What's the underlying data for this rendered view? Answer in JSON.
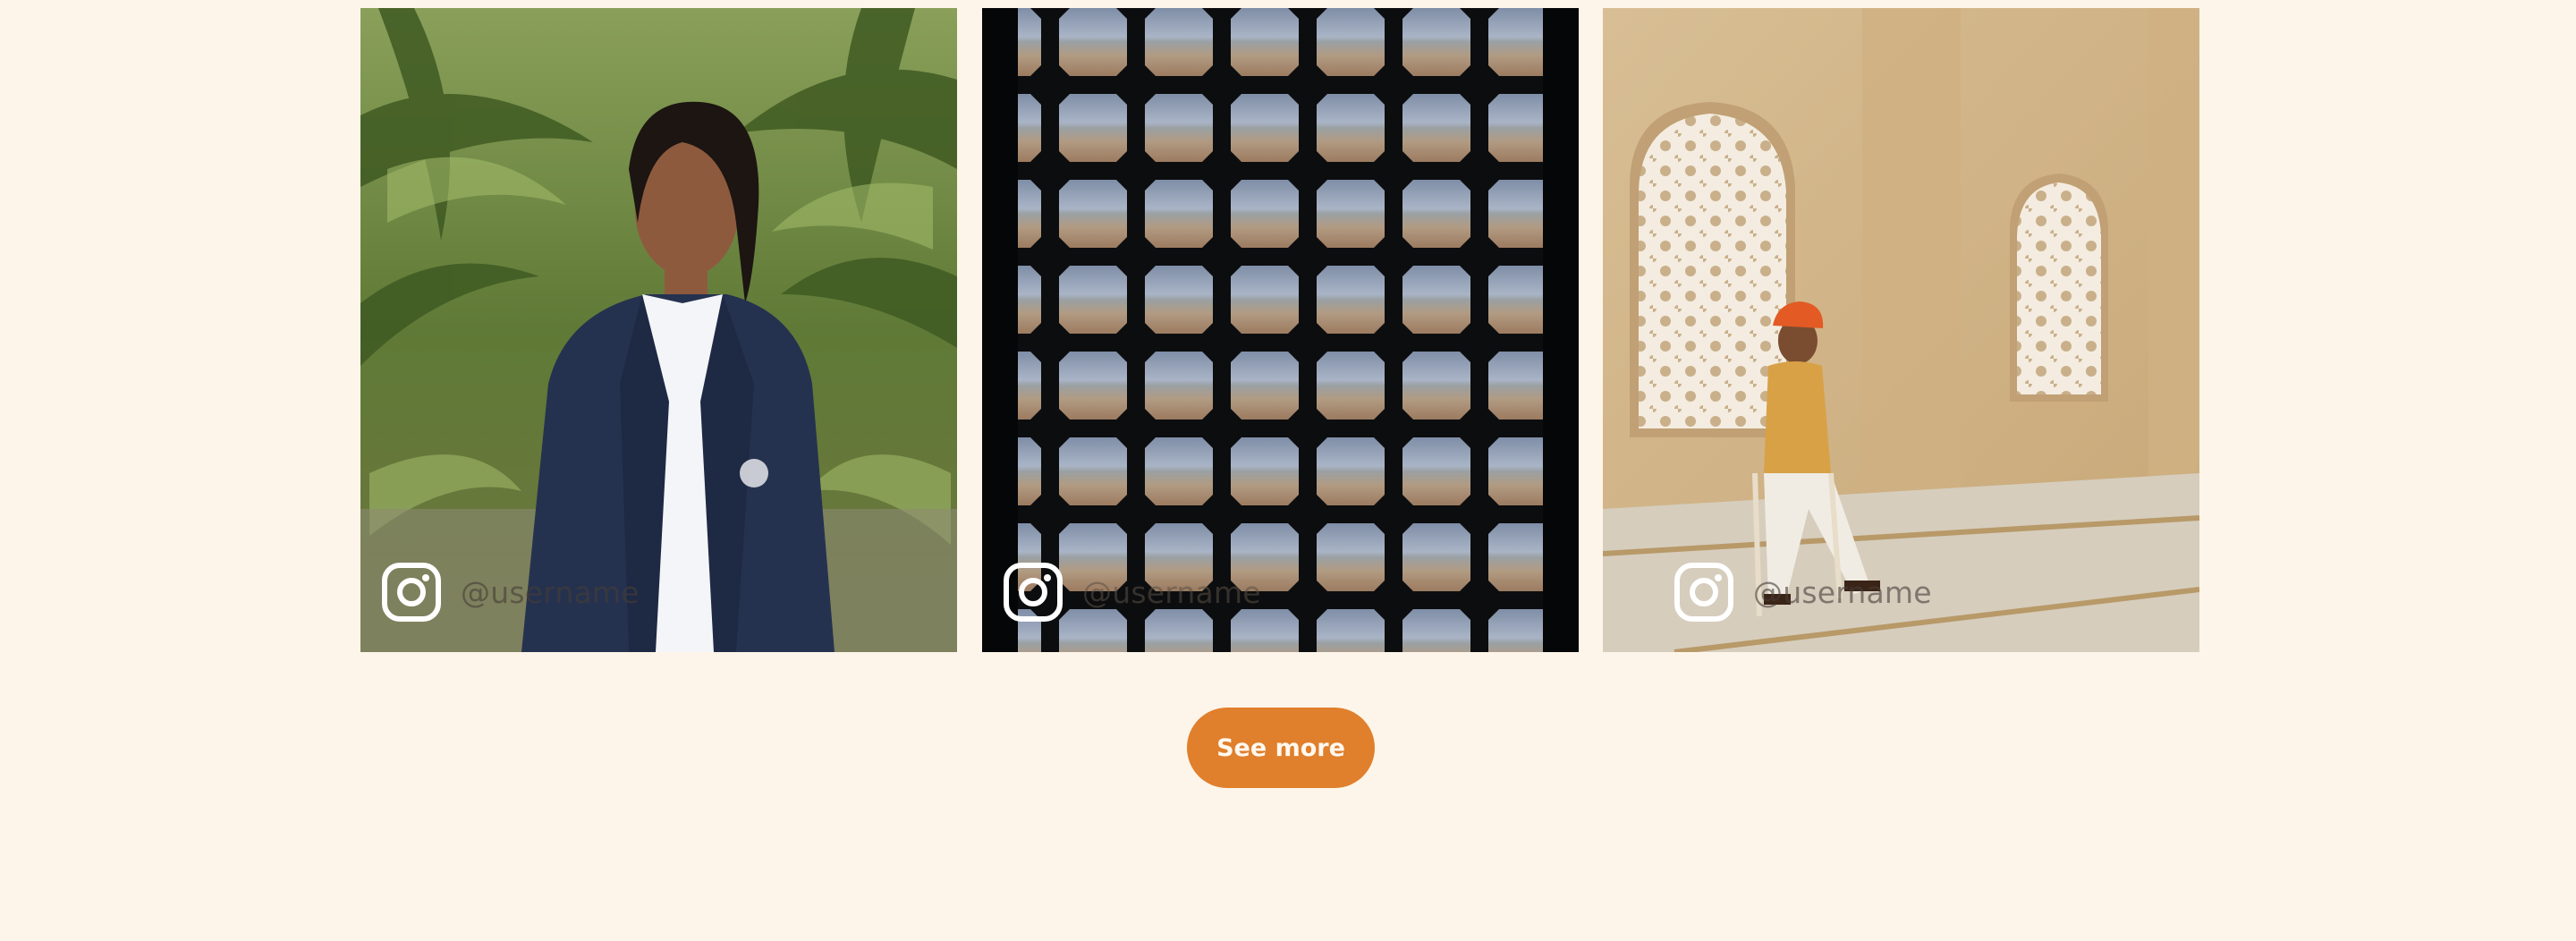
{
  "gallery": {
    "posts": [
      {
        "handle": "@username",
        "icon": "instagram-icon",
        "photo": "woman in navy blazer in front of palm trees"
      },
      {
        "handle": "@username",
        "icon": "instagram-icon",
        "photo": "carved lattice window overlooking a city"
      },
      {
        "handle": "@username",
        "icon": "instagram-icon",
        "photo": "man in turban seated beside carved jali windows"
      }
    ]
  },
  "actions": {
    "see_more_label": "See more"
  },
  "colors": {
    "page_background": "#fdf5e9",
    "button_background": "#e07f2c",
    "button_text": "#fff8ef"
  }
}
